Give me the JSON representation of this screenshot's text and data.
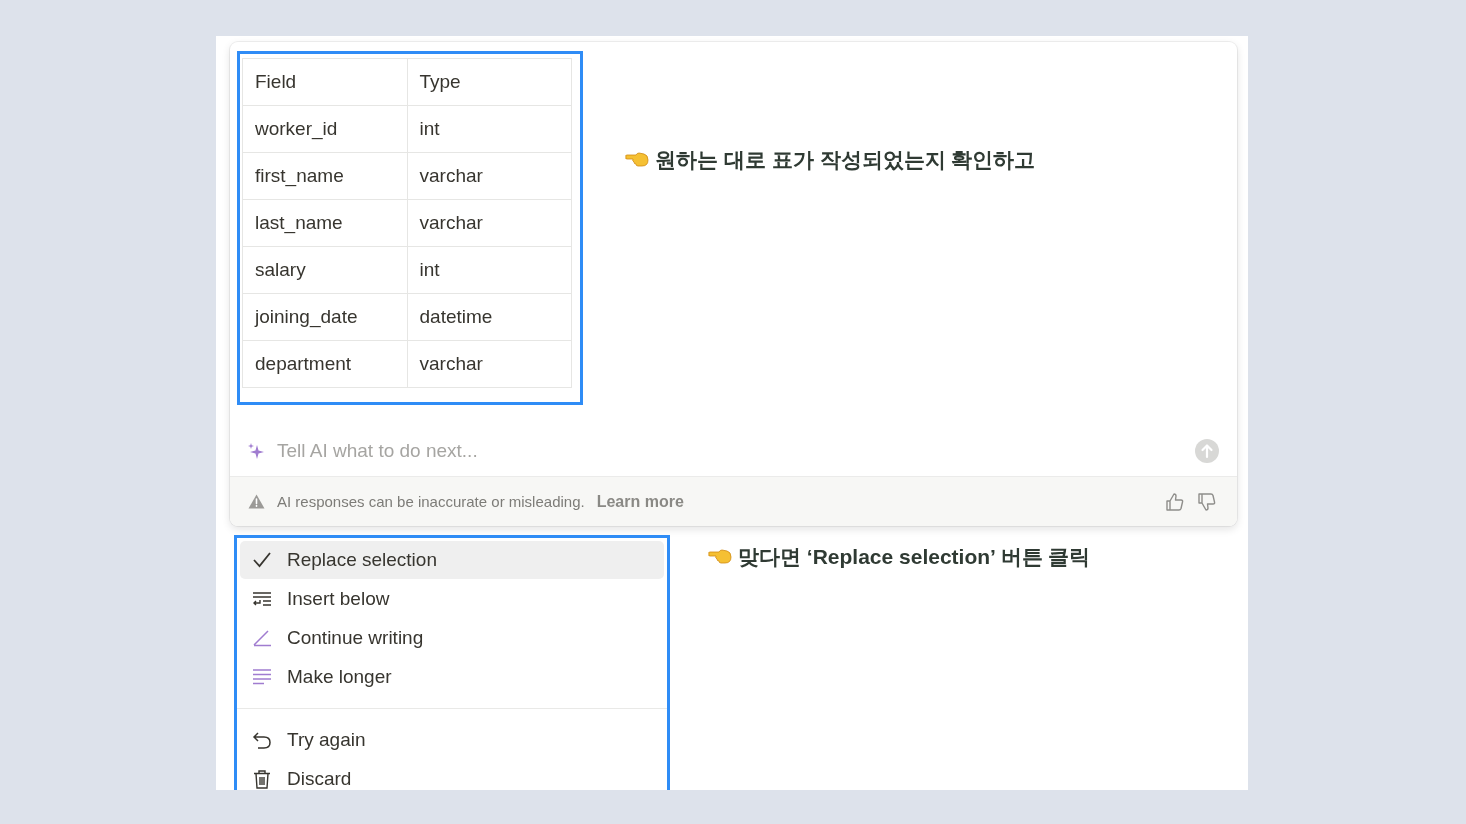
{
  "table": {
    "columns": [
      "Field",
      "Type"
    ],
    "rows": [
      [
        "worker_id",
        "int"
      ],
      [
        "first_name",
        "varchar"
      ],
      [
        "last_name",
        "varchar"
      ],
      [
        "salary",
        "int"
      ],
      [
        "joining_date",
        "datetime"
      ],
      [
        "department",
        "varchar"
      ]
    ]
  },
  "annotations": [
    "원하는 대로 표가 작성되었는지 확인하고",
    "맞다면 ‘Replace selection’ 버튼 클릭"
  ],
  "prompt": {
    "placeholder": "Tell AI what to do next..."
  },
  "footer": {
    "notice": "AI responses can be inaccurate or misleading.",
    "link": "Learn more"
  },
  "menu": {
    "groups": [
      [
        {
          "label": "Replace selection",
          "selected": true
        },
        {
          "label": "Insert below",
          "selected": false
        },
        {
          "label": "Continue writing",
          "selected": false
        },
        {
          "label": "Make longer",
          "selected": false
        }
      ],
      [
        {
          "label": "Try again",
          "selected": false
        },
        {
          "label": "Discard",
          "selected": false
        }
      ]
    ]
  }
}
